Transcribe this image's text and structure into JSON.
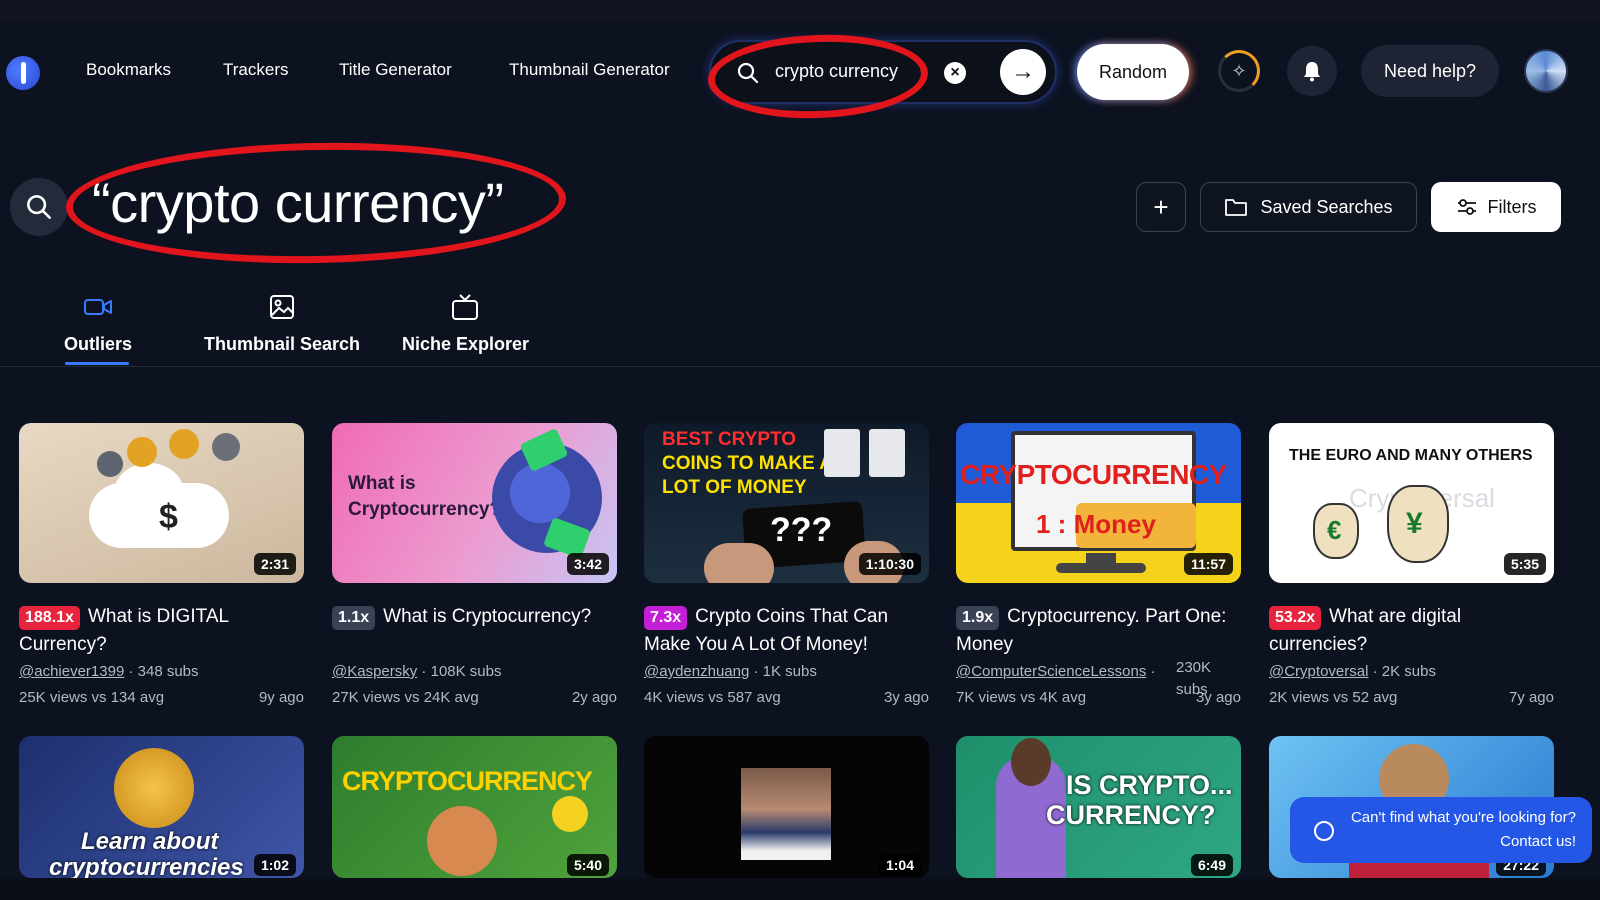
{
  "nav": {
    "links": [
      "Bookmarks",
      "Trackers",
      "Title Generator",
      "Thumbnail Generator"
    ],
    "search_value": "crypto currency",
    "random_label": "Random",
    "help_label": "Need help?"
  },
  "search": {
    "query_title": "“crypto currency”",
    "saved_label": "Saved Searches",
    "filters_label": "Filters"
  },
  "tabs": [
    {
      "label": "Outliers",
      "active": true
    },
    {
      "label": "Thumbnail Search",
      "active": false
    },
    {
      "label": "Niche Explorer",
      "active": false
    }
  ],
  "cards": [
    {
      "title": "What is DIGITAL Currency?",
      "multiplier": "188.1x",
      "badge_color": "#e8233d",
      "channel": "@achiever1399",
      "subs": "348 subs",
      "views": "25K views vs 134 avg",
      "age": "9y ago",
      "duration": "2:31"
    },
    {
      "title": "What is Cryptocurrency?",
      "multiplier": "1.1x",
      "badge_color": "#3a4256",
      "channel": "@Kaspersky",
      "subs": "108K subs",
      "views": "27K views vs 24K avg",
      "age": "2y ago",
      "duration": "3:42"
    },
    {
      "title": "Crypto Coins That Can Make You A Lot Of Money!",
      "multiplier": "7.3x",
      "badge_color": "#c41fd6",
      "channel": "@aydenzhuang",
      "subs": "1K subs",
      "views": "4K views vs 587 avg",
      "age": "3y ago",
      "duration": "1:10:30"
    },
    {
      "title": "Cryptocurrency. Part One: Money",
      "multiplier": "1.9x",
      "badge_color": "#3a4256",
      "channel": "@ComputerScienceLessons",
      "subs": "230K subs",
      "views": "7K views vs 4K avg",
      "age": "3y ago",
      "duration": "11:57"
    },
    {
      "title": "What are digital currencies?",
      "multiplier": "53.2x",
      "badge_color": "#e8233d",
      "channel": "@Cryptoversal",
      "subs": "2K subs",
      "views": "2K views vs 52 avg",
      "age": "7y ago",
      "duration": "5:35"
    }
  ],
  "row2_durations": [
    "1:02",
    "5:40",
    "1:04",
    "6:49",
    "27:22"
  ],
  "thumb_text": {
    "t2": "What is Cryptocurrency?",
    "t3a": "BEST CRYPTO",
    "t3b": "COINS TO MAKE A",
    "t3c": "LOT OF MONEY",
    "t3q": "???",
    "t4a": "CRYPTOCURRENCY",
    "t4b": "1 : Money",
    "t5a": "THE EURO AND MANY OTHERS",
    "t5b": "Cryptoversal",
    "r2a": "Learn about",
    "r2b": "cryptocurrencies",
    "r2c": "CRYPTOCURRENCY",
    "r2d": "IS CRYPTO...",
    "r2e": "CURRENCY?"
  },
  "contact": {
    "line1": "Can't find what you're looking for?",
    "line2": "Contact us!"
  },
  "colors": {
    "accent": "#3b7bff",
    "annotation_red": "#e3151c",
    "background": "#0d1220"
  }
}
